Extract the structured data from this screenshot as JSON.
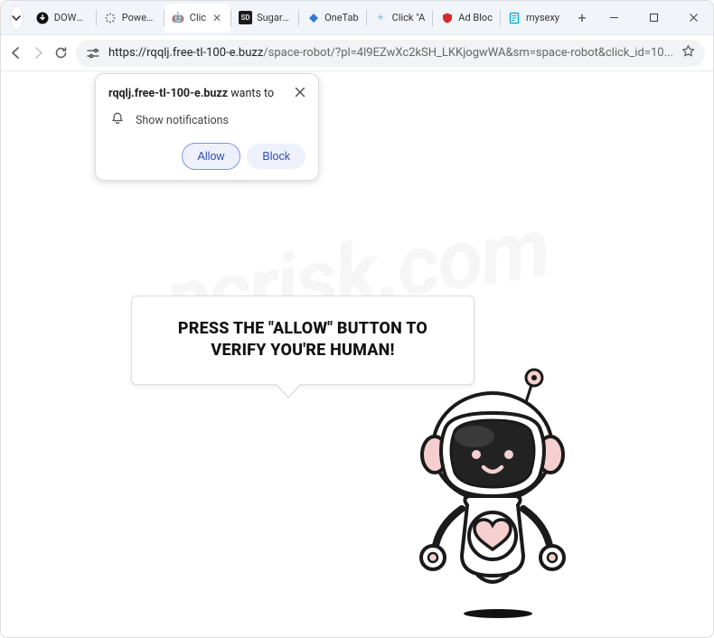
{
  "tabs": [
    {
      "title": "DOWNL"
    },
    {
      "title": "Power B"
    },
    {
      "title": "Clic"
    },
    {
      "title": "Sugar D"
    },
    {
      "title": "OneTab"
    },
    {
      "title": "Click \"A"
    },
    {
      "title": "Ad Bloc"
    },
    {
      "title": "mysexy"
    }
  ],
  "address": {
    "prefix": "https://",
    "domain": "rqqlj.free-tl-100-e.buzz",
    "path": "/space-robot/?pl=4l9EZwXc2kSH_LKKjogwWA&sm=space-robot&click_id=10..."
  },
  "popup": {
    "domain": "rqqlj.free-tl-100-e.buzz",
    "wants": "wants to",
    "message": "Show notifications",
    "allow": "Allow",
    "block": "Block"
  },
  "bubble": {
    "text": "PRESS THE \"ALLOW\" BUTTON TO VERIFY YOU'RE HUMAN!"
  },
  "watermark": "pcrisk.com"
}
